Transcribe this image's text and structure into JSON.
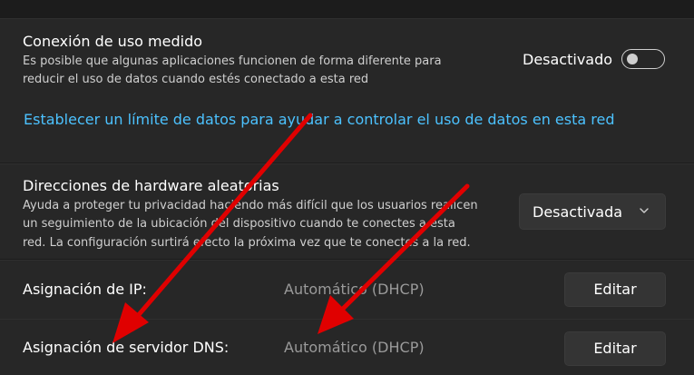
{
  "metered": {
    "title": "Conexión de uso medido",
    "desc_line1": "Es posible que algunas aplicaciones funcionen de forma diferente para",
    "desc_line2": "reducir el uso de datos cuando estés conectado a esta red",
    "toggle_label": "Desactivado",
    "toggle_on": false,
    "link": "Establecer un límite de datos para ayudar a controlar el uso de datos en esta red"
  },
  "random_hw": {
    "title": "Direcciones de hardware aleatorias",
    "desc_line1": "Ayuda a proteger tu privacidad haciendo más difícil que los usuarios realicen",
    "desc_line2": "un seguimiento de la ubicación del dispositivo cuando te conectes a esta",
    "desc_line3": "red. La configuración surtirá efecto la próxima vez que te conectes a la red.",
    "dropdown_value": "Desactivada"
  },
  "ip_assignment": {
    "label": "Asignación de IP:",
    "value": "Automático (DHCP)",
    "button": "Editar"
  },
  "dns_assignment": {
    "label": "Asignación de servidor DNS:",
    "value": "Automático (DHCP)",
    "button": "Editar"
  },
  "colors": {
    "background": "#1c1c1c",
    "card": "#272727",
    "link": "#4cc2ff",
    "annotation_arrow": "#e00000"
  },
  "icons": [
    "toggle-switch",
    "chevron-down-icon",
    "red-arrow-annotation"
  ]
}
